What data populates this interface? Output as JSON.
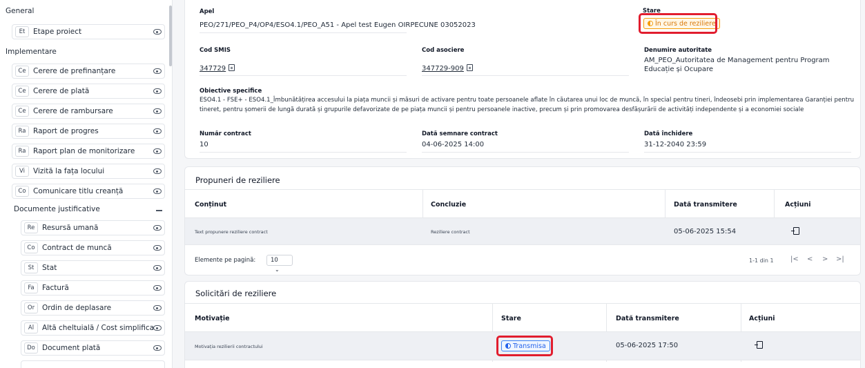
{
  "sidebar": {
    "section_general": "General",
    "section_implementare": "Implementare",
    "section_documente": "Documente justificative",
    "general_items": [
      {
        "abbr": "Et",
        "label": "Etape proiect"
      }
    ],
    "implementare_items": [
      {
        "abbr": "Ce",
        "label": "Cerere de prefinanțare"
      },
      {
        "abbr": "Ce",
        "label": "Cerere de plată"
      },
      {
        "abbr": "Ce",
        "label": "Cerere de rambursare"
      },
      {
        "abbr": "Ra",
        "label": "Raport de progres"
      },
      {
        "abbr": "Ra",
        "label": "Raport plan de monitorizare"
      },
      {
        "abbr": "Vi",
        "label": "Vizită la fața locului"
      },
      {
        "abbr": "Co",
        "label": "Comunicare titlu creanță"
      }
    ],
    "document_items": [
      {
        "abbr": "Re",
        "label": "Resursă umană"
      },
      {
        "abbr": "Co",
        "label": "Contract de muncă"
      },
      {
        "abbr": "St",
        "label": "Stat"
      },
      {
        "abbr": "Fa",
        "label": "Factură"
      },
      {
        "abbr": "Or",
        "label": "Ordin de deplasare"
      },
      {
        "abbr": "Al",
        "label": "Altă cheltuială / Cost simplificat"
      },
      {
        "abbr": "Do",
        "label": "Document plată"
      }
    ]
  },
  "details": {
    "apel_label": "Apel",
    "apel_value": "PEO/271/PEO_P4/OP4/ESO4.1/PEO_A51 - Apel test Eugen OIRPECUNE 03052023",
    "stare_label": "Stare",
    "stare_value": "În curs de reziliere",
    "cod_smis_label": "Cod SMIS",
    "cod_smis_value": "347729",
    "cod_asociere_label": "Cod asociere",
    "cod_asociere_value": "347729-909",
    "autoritate_label": "Denumire autoritate",
    "autoritate_value": "AM_PEO_Autoritatea de Management pentru Program Educație și Ocupare",
    "obiective_label": "Obiective specifice",
    "obiective_line1": "ESO4.1 - FSE+ - ESO4.1_Îmbunătățirea accesului la piața muncii și măsuri de activare pentru toate persoanele aflate în căutarea unui loc de muncă, în special pentru tineri, îndeosebi prin implementarea Garanției pentru",
    "obiective_line2": "tineret, pentru șomerii de lungă durată și grupurile defavorizate de pe piața muncii și pentru persoanele inactive, precum și prin promovarea desfășurării de activități independente și a economiei sociale",
    "contract_label": "Număr contract",
    "contract_value": "10",
    "semnare_label": "Dată semnare contract",
    "semnare_value": "04-06-2025 14:00",
    "inchidere_label": "Dată închidere",
    "inchidere_value": "31-12-2040 23:59"
  },
  "propuneri": {
    "title": "Propuneri de reziliere",
    "headers": [
      "Conținut",
      "Concluzie",
      "Dată transmitere",
      "Acțiuni"
    ],
    "row": {
      "continut": "Text propunere reziliere contract",
      "concluzie": "Reziliere contract",
      "data": "05-06-2025 15:54"
    },
    "per_page_label": "Elemente pe pagină:",
    "per_page_value": "10",
    "range": "1-1 din 1"
  },
  "solicitari": {
    "title": "Solicitări de reziliere",
    "headers": [
      "Motivație",
      "Stare",
      "Dată transmitere",
      "Acțiuni"
    ],
    "row": {
      "motivatie": "Motivația rezilierii contractului",
      "stare": "Transmisa",
      "data": "05-06-2025 17:50"
    }
  },
  "colors": {
    "highlight": "#e11d2e",
    "status_orange": "#f59e0b",
    "status_blue": "#2563eb"
  },
  "icons": [
    "eye-icon",
    "copy-icon",
    "document-action-icon",
    "chevron-down-icon",
    "first-page-icon",
    "prev-page-icon",
    "next-page-icon",
    "last-page-icon"
  ]
}
